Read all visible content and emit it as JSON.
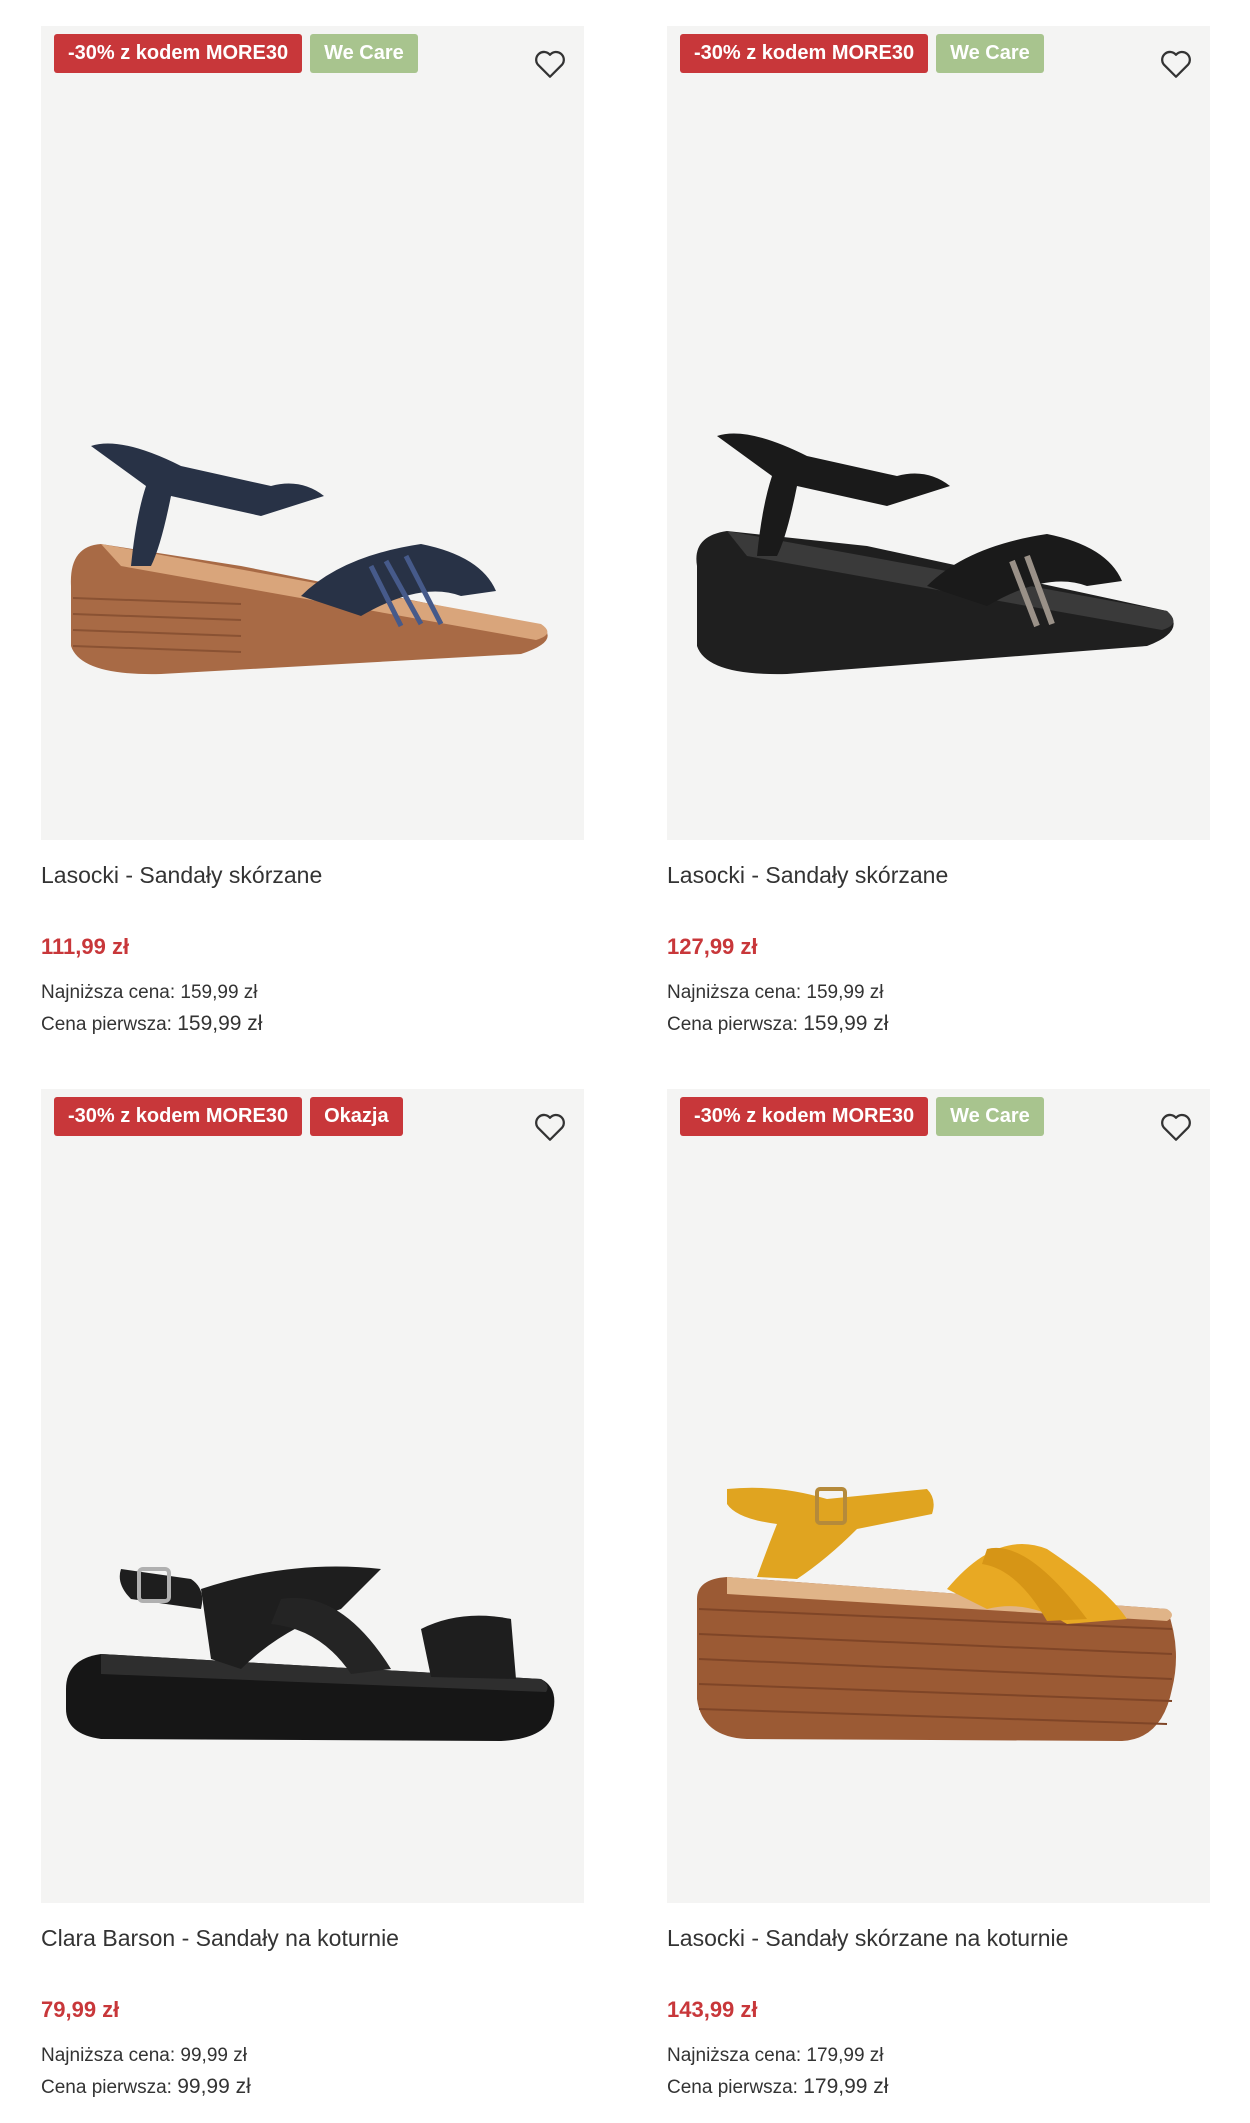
{
  "colors": {
    "promo": "#c8373a",
    "care": "#a8c48e"
  },
  "products": [
    {
      "badges": [
        {
          "type": "promo",
          "text": "-30% z kodem MORE30"
        },
        {
          "type": "care",
          "text": "We Care"
        }
      ],
      "favorite_icon": "heart-outline-icon",
      "image": "navy wedge sandal",
      "title": "Lasocki - Sandały skórzane",
      "price": "111,99 zł",
      "lowest_label": "Najniższa cena:",
      "lowest_value": "159,99 zł",
      "first_label": "Cena pierwsza:",
      "first_value": "159,99 zł"
    },
    {
      "badges": [
        {
          "type": "promo",
          "text": "-30% z kodem MORE30"
        },
        {
          "type": "care",
          "text": "We Care"
        }
      ],
      "favorite_icon": "heart-outline-icon",
      "image": "black wedge sandal",
      "title": "Lasocki - Sandały skórzane",
      "price": "127,99 zł",
      "lowest_label": "Najniższa cena:",
      "lowest_value": "159,99 zł",
      "first_label": "Cena pierwsza:",
      "first_value": "159,99 zł"
    },
    {
      "badges": [
        {
          "type": "promo",
          "text": "-30% z kodem MORE30"
        },
        {
          "type": "deal",
          "text": "Okazja"
        }
      ],
      "favorite_icon": "heart-outline-icon",
      "image": "black flatform sandal",
      "title": "Clara Barson - Sandały na koturnie",
      "price": "79,99 zł",
      "lowest_label": "Najniższa cena:",
      "lowest_value": "99,99 zł",
      "first_label": "Cena pierwsza:",
      "first_value": "99,99 zł"
    },
    {
      "badges": [
        {
          "type": "promo",
          "text": "-30% z kodem MORE30"
        },
        {
          "type": "care",
          "text": "We Care"
        }
      ],
      "favorite_icon": "heart-outline-icon",
      "image": "yellow platform wedge sandal",
      "title": "Lasocki - Sandały skórzane na koturnie",
      "price": "143,99 zł",
      "lowest_label": "Najniższa cena:",
      "lowest_value": "179,99 zł",
      "first_label": "Cena pierwsza:",
      "first_value": "179,99 zł"
    }
  ]
}
